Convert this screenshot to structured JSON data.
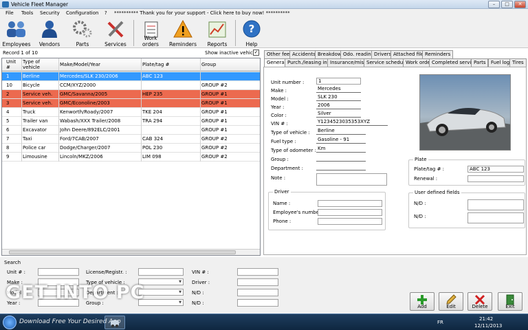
{
  "window": {
    "title": "Vehicle Fleet Manager"
  },
  "menu": [
    "File",
    "Tools",
    "Security",
    "Configuration",
    "?",
    "********** Thank you for your support - Click here to buy now! **********"
  ],
  "toolbar": {
    "employees": "Employees",
    "vendors": "Vendors",
    "parts": "Parts",
    "services": "Services",
    "work_orders": "Work orders",
    "reminders": "Reminders",
    "reports": "Reports",
    "help": "Help"
  },
  "list": {
    "record": "Record 1 of 10",
    "show_inactive": "Show inactive vehicles",
    "columns": {
      "unit": "Unit #",
      "type": "Type of vehicle",
      "make": "Make/Model/Year",
      "plate": "Plate/tag #",
      "group": "Group"
    },
    "rows": [
      {
        "unit": "1",
        "type": "Berline",
        "make": "Mercedes/SLK 230/2006",
        "plate": "ABC 123",
        "group": ""
      },
      {
        "unit": "10",
        "type": "Bicycle",
        "make": "CCM/XYZ/2000",
        "plate": "",
        "group": "GROUP #2"
      },
      {
        "unit": "2",
        "type": "Service veh.",
        "make": "GMC/Savanna/2005",
        "plate": "HEP 235",
        "group": "GROUP #1"
      },
      {
        "unit": "3",
        "type": "Service veh.",
        "make": "GMC/Econoline/2003",
        "plate": "",
        "group": "GROUP #1"
      },
      {
        "unit": "4",
        "type": "Truck",
        "make": "Kenworth/Roady/2007",
        "plate": "TKE 204",
        "group": "GROUP #1"
      },
      {
        "unit": "5",
        "type": "Trailer van",
        "make": "Wabash/XXX Trailer/2008",
        "plate": "TRA 294",
        "group": "GROUP #1"
      },
      {
        "unit": "6",
        "type": "Excavator",
        "make": "John Deere/892ELC/2001",
        "plate": "",
        "group": "GROUP #1"
      },
      {
        "unit": "7",
        "type": "Taxi",
        "make": "Ford/7CAB/2007",
        "plate": "CAB 324",
        "group": "GROUP #2"
      },
      {
        "unit": "8",
        "type": "Police car",
        "make": "Dodge/Charger/2007",
        "plate": "POL 230",
        "group": "GROUP #2"
      },
      {
        "unit": "9",
        "type": "Limousine",
        "make": "Lincoln/MKZ/2006",
        "plate": "LIM 098",
        "group": "GROUP #2"
      }
    ]
  },
  "tabs_top": [
    "Other fees",
    "Accidents",
    "Breakdown",
    "Odo. reading",
    "Drivers",
    "Attached files",
    "Reminders"
  ],
  "tabs_bottom": [
    "General",
    "Purch./leasing info.",
    "Insurance/misc.",
    "Service schedule",
    "Work order",
    "Completed services",
    "Parts",
    "Fuel log",
    "Tires"
  ],
  "details": {
    "unit_label": "Unit number :",
    "unit": "1",
    "make_label": "Make :",
    "make": "Mercedes",
    "model_label": "Model :",
    "model": "SLK 230",
    "year_label": "Year :",
    "year": "2006",
    "color_label": "Color :",
    "color": "Silver",
    "vin_label": "VIN # :",
    "vin": "Y1234523035353XYZ",
    "type_label": "Type of vehicle :",
    "type": "Berline",
    "fuel_label": "Fuel type :",
    "fuel": "Gasoline - 91",
    "odo_label": "Type of odometer :",
    "odo": "Km",
    "group_label": "Group :",
    "department_label": "Department :",
    "note_label": "Note :"
  },
  "driver": {
    "legend": "Driver",
    "name": "Name :",
    "employee": "Employee's number :",
    "phone": "Phone :"
  },
  "plate": {
    "legend": "Plate",
    "tag_label": "Plate/tag # :",
    "tag": "ABC 123",
    "renewal": "Renewal :"
  },
  "user_fields": {
    "legend": "User defined fields",
    "nd1": "N/D :",
    "nd2": "N/D :"
  },
  "search": {
    "legend": "Search",
    "unit": "Unit # :",
    "license": "License/Registr. :",
    "vin": "VIN # :",
    "make": "Make :",
    "type": "Type of vehicle :",
    "driver": "Driver :",
    "model": "Model :",
    "department": "Department :",
    "nd1": "N/D :",
    "year": "Year :",
    "group": "Group :",
    "nd2": "N/D :"
  },
  "actions": {
    "add": "Add",
    "edit": "Edit",
    "delete": "Delete",
    "exit": "Exit"
  },
  "watermark": {
    "main": "GET INTO PC",
    "sub": "Download Free Your Desired App"
  },
  "taskbar": {
    "lang": "FR",
    "time": "21:42",
    "date": "12/11/2013"
  },
  "colors": {
    "selected": "#3399ff",
    "highlight": "#ec6a4f",
    "accent": "#2a6fb0"
  }
}
